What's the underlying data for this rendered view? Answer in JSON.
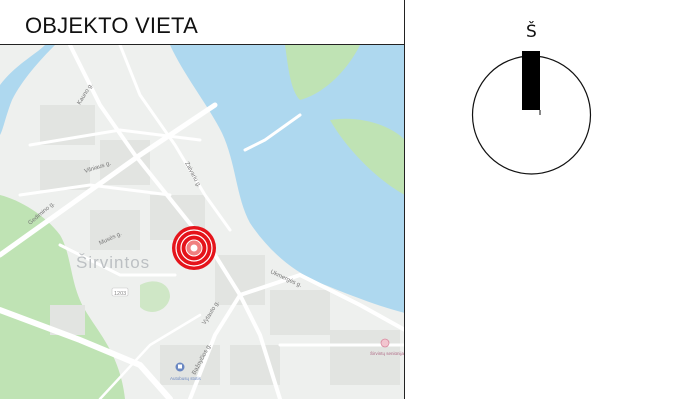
{
  "header": {
    "title": "OBJEKTO VIETA"
  },
  "map": {
    "town_label": "Širvintos",
    "streets": [
      "Kauno g.",
      "Vilniaus g.",
      "Zalvariu g.",
      "Gedimino g.",
      "Ukmergės g.",
      "Vytauto g.",
      "Bažnyčios g.",
      "Musės g."
    ],
    "poi": [
      "Širvintų seniūnija",
      "Autobusų stotis"
    ],
    "road_number": "1203",
    "colors": {
      "water": "#aed8ef",
      "park": "#bfe3b4",
      "land": "#eef0ee",
      "block": "#e2e4e1",
      "road": "#ffffff",
      "marker": "#e5141b"
    }
  },
  "compass": {
    "north_label": "Š"
  }
}
